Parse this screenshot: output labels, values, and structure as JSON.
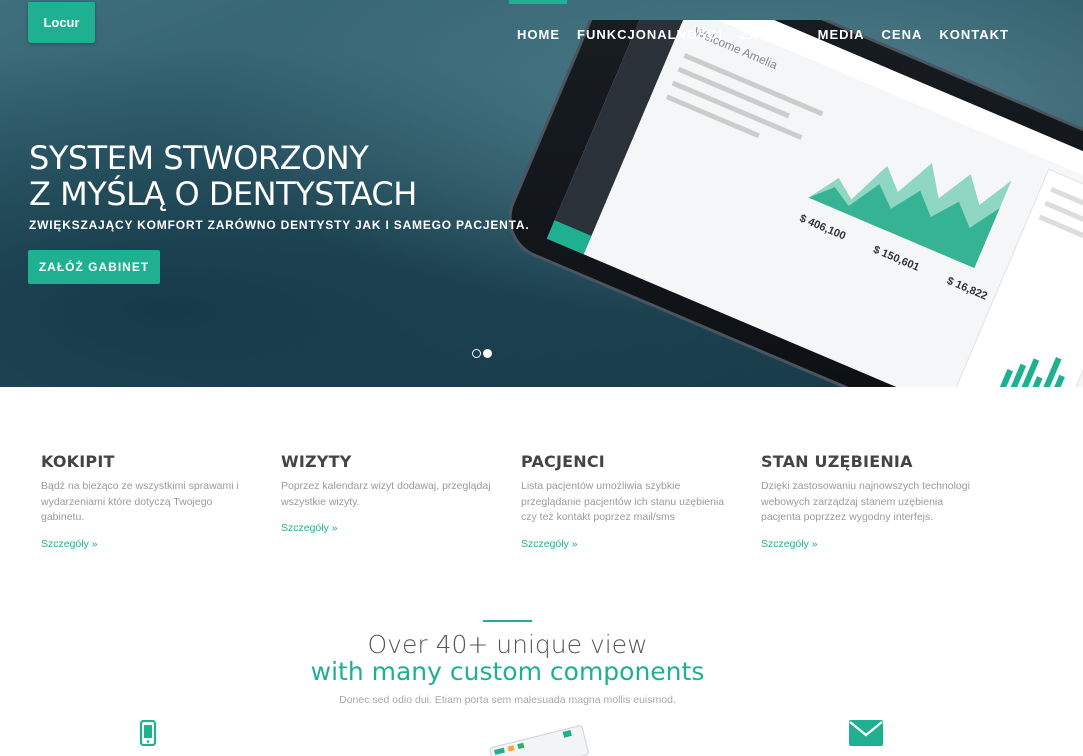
{
  "brand": {
    "label": "Locur"
  },
  "nav": {
    "items": [
      {
        "label": "HOME",
        "active": true
      },
      {
        "label": "FUNKCJONALNOŚCI",
        "active": false
      },
      {
        "label": "ZAŁOGA",
        "active": false
      },
      {
        "label": "MEDIA",
        "active": false
      },
      {
        "label": "CENA",
        "active": false
      },
      {
        "label": "KONTAKT",
        "active": false
      }
    ]
  },
  "hero": {
    "title_line1": "SYSTEM STWORZONY",
    "title_line2": "Z MYŚLĄ O DENTYSTACH",
    "subtitle": "ZWIĘKSZAJĄCY KOMFORT ZARÓWNO DENTYSTY JAK I SAMEGO PACJENTA.",
    "cta_label": "ZAŁÓŻ GABINET",
    "slides_count": 2,
    "active_slide": 2
  },
  "phone_screen": {
    "welcome": "Welcome Amelia",
    "stats": [
      "$ 406,100",
      "$ 150,601",
      "$ 16,822"
    ]
  },
  "features": [
    {
      "title": "KOKIPIT",
      "text": "Bądź na bieżąco ze wszystkimi sprawami i wydarzeniami które dotyczą Twojego gabinetu.",
      "link": "Szczegóły »"
    },
    {
      "title": "WIZYTY",
      "text": "Poprzez kalendarz wizyt dodawaj, przeglądaj wszystkie wizyty.",
      "link": "Szczegóły »"
    },
    {
      "title": "PACJENCI",
      "text": "Lista pacjentów umożliwia szybkie przeglądanie pacjentów ich stanu uzębienia czy też kontakt poprzez mail/sms",
      "link": "Szczegóły »"
    },
    {
      "title": "STAN UZĘBIENIA",
      "text": "Dzięki zastosowaniu najnowszych technologi webowych zarządzaj stanem uzębienia pacjenta poprzzez wygodny interfejs.",
      "link": "Szczegóły »"
    }
  ],
  "section2": {
    "title_line1": "Over 40+ unique view",
    "title_line2": "with many custom components",
    "subtitle": "Donec sed odio dui. Etiam porta sem malesuada magna mollis euismod."
  },
  "colors": {
    "accent": "#1fb092",
    "hero_dark": "#1d4250"
  },
  "icons": {
    "left": "mobile-phone-icon",
    "center": "tablet-device-icon",
    "right": "envelope-icon"
  }
}
